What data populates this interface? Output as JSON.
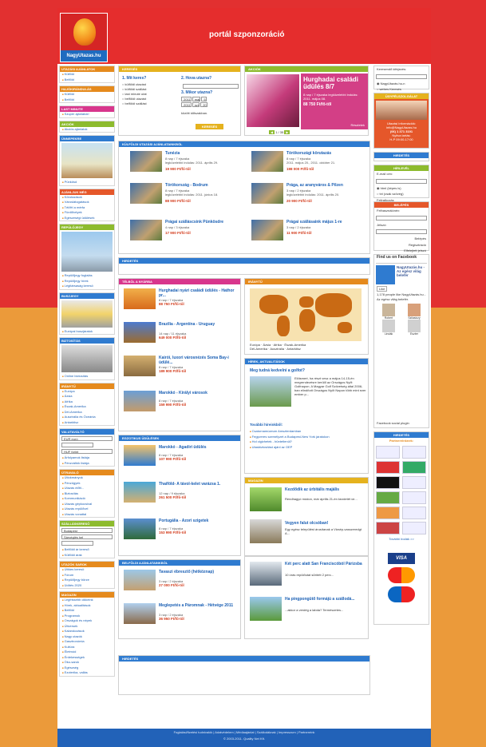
{
  "header": {
    "title": "portál szponzoráció",
    "logo_text": "NagyUtazas.hu"
  },
  "left": {
    "utazasi_ajanlatok": {
      "title": "UTAZÁSI AJÁNLATOK",
      "items": [
        "Külföld",
        "Belföld"
      ]
    },
    "hajokiranduls": {
      "title": "HAJÓKIRÁNDULÁS",
      "items": [
        "Külföld",
        "Belföld"
      ]
    },
    "last_minute": {
      "title": "LAST MINUTE",
      "items": [
        "Szuper ajánlatok!"
      ]
    },
    "akciok": {
      "title": "AKCIÓK",
      "items": [
        "Akciós ajánlatok"
      ]
    },
    "unnepekre": {
      "title": "ÜNNEPEKRE",
      "items": [
        "Pünkösd"
      ]
    },
    "ajanlunk": {
      "title": "AJÁNLJUK MÉG",
      "items": [
        "Körutazások",
        "Városlátogatások",
        "Tél/fél a mérfa",
        "Fürdőhelyek",
        "Egészeségi üdülések"
      ]
    },
    "repulojegy": {
      "title": "REPÜLŐJEGY",
      "items": [
        "Repülőjegy foglalás",
        "Repülőjegy hírek",
        "Légitársaság keresö"
      ]
    },
    "buszjegy": {
      "title": "BUSZJEGY",
      "items": [
        "Európai buszjáratok"
      ]
    },
    "biztositas": {
      "title": "BIZTOSÍTÁS",
      "items": [
        "Online biztosítás"
      ]
    },
    "irany": {
      "title": "IRÁNYTŰ",
      "items": [
        "Európa",
        "Ázsia",
        "Afrika",
        "Észak-Amerika",
        "Dél-Amerika",
        "Ausztrália és Óceánia",
        "Antarktisz"
      ]
    },
    "valuta": {
      "title": "VALUTAVÁLTÓ",
      "from": "EUR euró",
      "to": "HUF forint",
      "items": [
        "Árfolyamok listája",
        "Pénzváltók listája"
      ]
    },
    "utravalo": {
      "title": "ÚTRAVALÓ",
      "items": [
        "Útiokmányok",
        "Pénzügyek",
        "Utazás előtt...",
        "Biztosítás",
        "Kommunikáció",
        "Utazás gépkocsival",
        "Utazás repülővel",
        "Utazás vonattal"
      ]
    },
    "szallaskereso": {
      "title": "SZÁLLÁSKERESŐ",
      "city": "Budapest",
      "type": "Sárvéglés hel",
      "button": "Belföldi ár kereső",
      "link": "Külföldi árak"
    },
    "utazok": {
      "title": "UTAZÓK SAROK",
      "items": [
        "Útitárs keresö",
        "Fórum",
        "Repülőjegy börze",
        "Üdítés 2020"
      ]
    },
    "magazin": {
      "title": "MAGAZIN",
      "items": [
        "Legfrissebb cikkeink",
        "Hírek, aktualitások",
        "Belföld",
        "Programok",
        "Országok és népek",
        "Útiversek",
        "Kalandozások",
        "Nagy utazók",
        "Gasztronómia",
        "Kultúra",
        "Életmód",
        "Érdekességek",
        "Öko-sarok",
        "Egészség",
        "Ezoterika, vallás"
      ]
    }
  },
  "search": {
    "title": "KERESÉS",
    "q1": "1. Mit keres?",
    "q2": "2. Hova utazna?",
    "q3": "3. Mikor utazna?",
    "opts": [
      "külföldi utazást",
      "külföldi szállást",
      "last minute utat",
      "belföldi utazást",
      "belföldi szállást"
    ],
    "year": "2011",
    "month": "máj",
    "day": "5",
    "year2": "2011",
    "month2": "szr",
    "day2": "20",
    "hint": "között időszakban.",
    "button": "KERESÉS"
  },
  "akcio": {
    "title": "AKCIÓK",
    "heading": "Hurghadai családi üdülés 8/7",
    "desc": "8 nap / 7 éjszaka legközelebbi indulás: 2011. május 08.",
    "price": "88 750 Ft/fő-től",
    "counter": "1 / 35",
    "more": "Részletek"
  },
  "kulfoldi": {
    "title": "KÜLFÖLDI UTAZÁSI AJÁNLATAINKBÓL",
    "deals": [
      {
        "t": "Tunézia",
        "d1": "8 nap / 7 éjszaka",
        "d2": "legközelebbi indulás: 2011. április 29.",
        "p": "19 900 Ft/fő-től"
      },
      {
        "t": "Törökországi körutazás",
        "d1": "8 nap / 7 éjszaka",
        "d2": "2011. május 20., 2011. október 21.",
        "p": "198 000 Ft/fő-től"
      },
      {
        "t": "Törökország - Bodrum",
        "d1": "8 nap / 7 éjszaka",
        "d2": "legközelebbi indulás: 2011. június 18.",
        "p": "88 900 Ft/fő-től"
      },
      {
        "t": "Prága, az aranyváros & Pilzen",
        "d1": "3 nap / 2 éjszaka",
        "d2": "legközelebbi indulás: 2011. április 20.",
        "p": "20 900 Ft/fő-től"
      },
      {
        "t": "Prágai szálláscsink Pünkösdre",
        "d1": "4 nap / 3 éjszaka",
        "d2": "",
        "p": "17 900 Ft/fő-től"
      },
      {
        "t": "Prágai szállásaink május 1-re",
        "d1": "3 nap / 2 éjszaka",
        "d2": "",
        "p": "11 900 Ft/fő-től"
      }
    ]
  },
  "hirdetes": "HIRDETÉS",
  "telbol": {
    "title": "TÉLBŐL A NYÁRBA",
    "deals": [
      {
        "t": "Hurghadai nyári családi üdülés - Hathor pr...",
        "d1": "8 nap / 7 éjszaka",
        "p": "88 750 Ft/fő-től"
      },
      {
        "t": "Brazília - Argentína - Uruguay",
        "d1": "14 nap / 11 éjszaka",
        "p": "649 000 Ft/fő-től"
      },
      {
        "t": "Kairói, luxori városnézés Soma Bay-i üdülé...",
        "d1": "8 nap / 7 éjszaka",
        "p": "189 900 Ft/fő-től"
      },
      {
        "t": "Marokkó - Királyi városok",
        "d1": "8 nap / 7 éjszaka",
        "p": "159 990 Ft/fő-től"
      }
    ]
  },
  "iranytu": {
    "title": "IRÁNYTŰ",
    "items": [
      "Európa",
      "Ázsia",
      "Afrika",
      "Észak-Amerika",
      "Dél-Amerika",
      "Ausztrália",
      "Antarktisz"
    ]
  },
  "hirek": {
    "title": "HÍREK, AKTUALITÁSOK",
    "headline": "Meg tudná kedvelni a golfot?",
    "text": "Elöismert, ha részt vesz a május 14-15-én megrendezésre kerülő az Országos Nyílt Golfnapon. A Magyar Golf Szövetség által 2006-ban elindított Országos Nyílt Napon több mint ezer ember p...",
    "more_title": "További híreinkből:",
    "more": [
      "Csatornamúzeum Amszterdamban",
      "Fegyveres személyzet a Budapest-New York járatokon",
      "Hol cigizhetek - büntetlenül?",
      "Utasbiztosítást ajánl az OEP"
    ]
  },
  "egzotikus": {
    "title": "EGZOTIKUS ÜDÜLÉSEK",
    "deals": [
      {
        "t": "Marokkó - Agadiri üdülés",
        "d1": "8 nap / 7 éjszaka",
        "p": "107 990 Ft/fő-től"
      },
      {
        "t": "Thaiföld- A távol-kelet varázsa 1.",
        "d1": "12 nap / 9 éjszaka",
        "p": "261 500 Ft/fő-től"
      },
      {
        "t": "Portugália - Azori szigetek",
        "d1": "8 nap / 7 éjszaka",
        "p": "153 990 Ft/fő-től"
      }
    ]
  },
  "magazin_box": {
    "title": "MAGAZIN",
    "items": [
      {
        "t": "Kezdődik az úrbitális majális",
        "d": "Rendhagyó módon, már április 21-én kezdetét ve..."
      },
      {
        "t": "Vegyen falut olcsóban!",
        "d": "Egy egész települést árusítanak a Vizsép-vasszeredgt A..."
      },
      {
        "t": "Két perc alatt San Franciscóból Párizsba",
        "d": "10 órás repülőutat sűrített 2 perc..."
      },
      {
        "t": "Ha pingpongütő formájú a szállodá...",
        "d": "...akkor a verdég a labda? Természetes..."
      }
    ]
  },
  "belfoldi": {
    "title": "BELFÖLDI AJÁNLATAINKBÓL",
    "deals": [
      {
        "t": "Tavaszi ébresztő (hétköznap)",
        "d1": "3 nap / 2 éjszaka",
        "p": "27 000 Ft/fő-től"
      },
      {
        "t": "Meglepetés a Páromnak - Hétvége 2011",
        "d1": "3 nap / 2 éjszaka",
        "p": "36 950 Ft/fő-től"
      }
    ]
  },
  "right": {
    "kereso": {
      "title": "Keresendő kifejezés:",
      "o1": "NagyUtazás.hu-n",
      "o2": "webes Keresés"
    },
    "ugyfel": {
      "title": "ÜGYFÉLSZOLGÁLAT",
      "l1": "Utazási információk:",
      "l2": "info@NagyUtazas.hu",
      "l3": "(06) 1 371 3191",
      "l4": "Nyitva tartás:",
      "l5": "H-P 09:00-17:00"
    },
    "hirdetes": "HIRDETÉS",
    "hirlevel": {
      "title": "HÍRLEVÉL",
      "label": "E-mail cím:",
      "o1": "html (képes is)",
      "o2": "txt (csak szöveg)",
      "sub": "Feliratkozás"
    },
    "belepes": {
      "title": "BELÉPÉS",
      "user": "Felhasználónév:",
      "pass": "Jelszó:",
      "b1": "Belépés",
      "b2": "Regisztráció",
      "b3": "Elfelejtett jelszó"
    },
    "facebook": {
      "title": "Find us on Facebook",
      "name": "NagyUtazás.hu - Az egész világ belefér",
      "like": "Like",
      "count": "1,178 people like NagyUtazás.hu - Az egész világ belefér.",
      "people": [
        "Robert",
        "Szilasiczy",
        "Lindák",
        "Eszter"
      ],
      "plugin": "Facebook social plugin"
    },
    "partners": {
      "title": "Partnereinknek:",
      "more": "További irodák >>"
    }
  },
  "footer": {
    "links": "Foglalási/fizetési tudnivalók | Adatvédelem | Médiaajánlat | Szállodáknak | Impresszum | Partnereink",
    "copy": "© 2003-2011. Quality Net Kft."
  }
}
